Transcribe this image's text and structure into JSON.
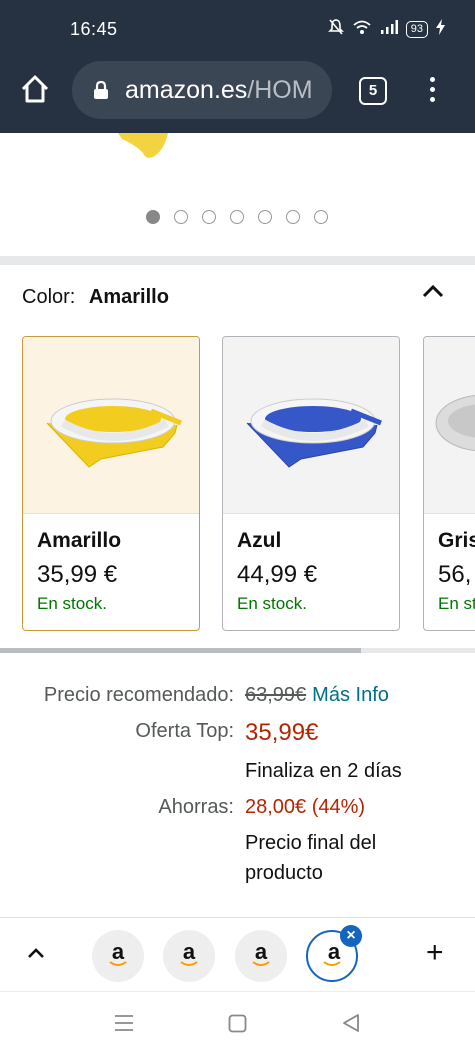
{
  "status": {
    "time": "16:45",
    "battery": "93"
  },
  "browser": {
    "url_host": "amazon.es",
    "url_path": "/HOM",
    "tab_count": "5"
  },
  "carousel": {
    "page_count": 7,
    "active_index": 0
  },
  "color_selector": {
    "label": "Color:",
    "selected": "Amarillo",
    "options": [
      {
        "name": "Amarillo",
        "price": "35,99 €",
        "stock": "En stock.",
        "tint": "#f2cd1f"
      },
      {
        "name": "Azul",
        "price": "44,99 €",
        "stock": "En stock.",
        "tint": "#3557c8"
      },
      {
        "name": "Gris",
        "price": "56,",
        "stock": "En st",
        "tint": "#c8c8c8"
      }
    ]
  },
  "pricing": {
    "recommended_label": "Precio recomendado:",
    "recommended_value": "63,99€",
    "more_info": "Más Info",
    "offer_label": "Oferta Top:",
    "offer_value": "35,99€",
    "ends": "Finaliza en 2 días",
    "savings_label": "Ahorras:",
    "savings_value": "28,00€ (44%)",
    "final_line1": "Precio final del",
    "final_line2": "producto"
  },
  "tab_strip": {
    "tab_letter": "a",
    "close": "×",
    "new_tab": "+"
  },
  "colors": {
    "toolbar": "#263241",
    "price_red": "#b12704",
    "stock_green": "#007600",
    "link": "#007185",
    "active_tab": "#1565c0"
  }
}
